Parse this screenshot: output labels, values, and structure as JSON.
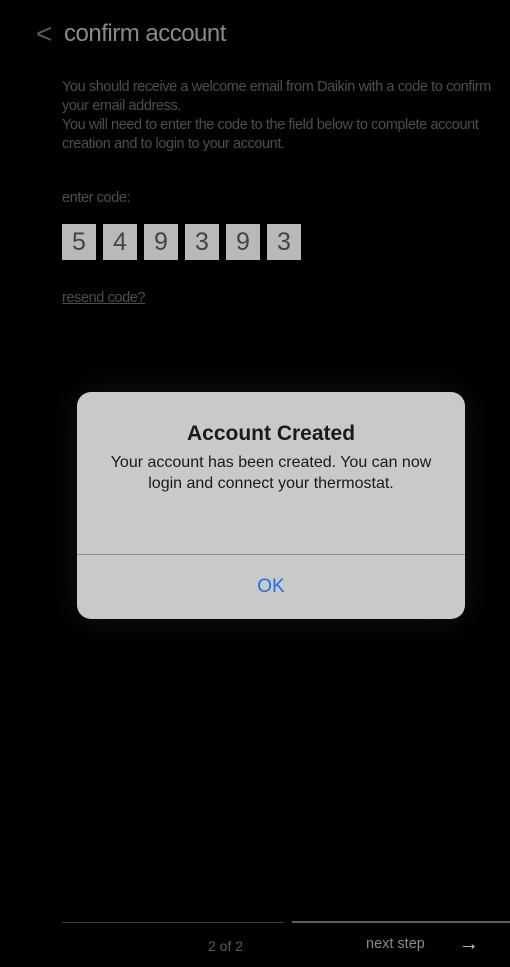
{
  "header": {
    "back_glyph": "<",
    "title": "confirm account"
  },
  "instructions": {
    "line1": "You should receive a welcome email from Daikin with a code to confirm your email address.",
    "line2": "You will need to enter the code to the field below to complete account creation and to login to your account."
  },
  "code": {
    "label": "enter code:",
    "digits": [
      "5",
      "4",
      "9",
      "3",
      "9",
      "3"
    ]
  },
  "resend_label": "resend code?",
  "dialog": {
    "title": "Account Created",
    "message": "Your account has been created.  You can now login and connect your thermostat.",
    "ok_label": "OK",
    "ok_color": "#1a73e8"
  },
  "footer": {
    "pager": "2 of 2",
    "next_label": "next step",
    "next_icon": "arrow-right-icon"
  }
}
